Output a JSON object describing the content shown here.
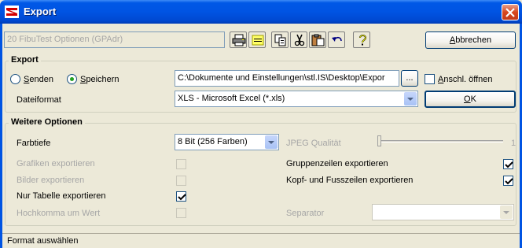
{
  "window": {
    "title": "Export",
    "close_label": "×"
  },
  "toolbar": {
    "profile_value": "20 FibuTest Optionen (GPAdr)",
    "cancel_label": "Abbrechen",
    "cancel_mnemonic": "A",
    "cancel_rest": "bbrechen"
  },
  "export_group": {
    "legend": "Export",
    "radio_send": {
      "mnemonic": "S",
      "rest": "enden",
      "checked": false
    },
    "radio_save": {
      "mnemonic": "S",
      "rest": "peichern",
      "checked": true
    },
    "path_value": "C:\\Dokumente und Einstellungen\\stl.IS\\Desktop\\Expor",
    "browse_label": "...",
    "open_after": {
      "mnemonic": "A",
      "rest": "nschl. öffnen",
      "checked": false
    },
    "format_label": "Dateiformat",
    "format_value": "XLS - Microsoft Excel (*.xls)",
    "ok_label": "OK",
    "ok_mnemonic": "O",
    "ok_rest": "K"
  },
  "options_group": {
    "legend": "Weitere Optionen",
    "color_depth_label": "Farbtiefe",
    "color_depth_value": "8 Bit (256 Farben)",
    "jpeg_label": "JPEG Qualität",
    "jpeg_value": "1",
    "jpeg_level": 0,
    "graphics_label": "Grafiken exportieren",
    "graphics_checked": false,
    "images_label": "Bilder exportieren",
    "images_checked": false,
    "table_only_label": "Nur Tabelle exportieren",
    "table_only_checked": true,
    "quote_label": "Hochkomma um Wert",
    "quote_checked": false,
    "group_rows_label": "Gruppenzeilen exportieren",
    "group_rows_checked": true,
    "header_footer_label": "Kopf- und Fusszeilen exportieren",
    "header_footer_checked": true,
    "separator_label": "Separator",
    "separator_value": ""
  },
  "status": {
    "text": "Format auswählen"
  },
  "colors": {
    "titlebar": "#0054e3",
    "window": "#ece9d8",
    "close": "#d8471e"
  }
}
